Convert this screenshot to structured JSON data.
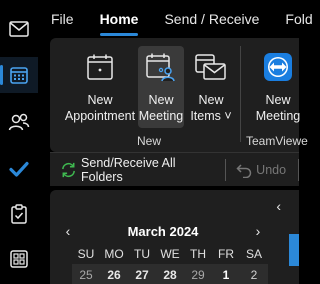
{
  "menu": {
    "tabs": [
      {
        "label": "File"
      },
      {
        "label": "Home"
      },
      {
        "label": "Send / Receive"
      },
      {
        "label": "Fold"
      }
    ],
    "active_tab": "Home"
  },
  "rail": {
    "items": [
      "mail-icon",
      "calendar-icon",
      "people-icon",
      "todo-check-icon",
      "clipboard-icon",
      "apps-icon"
    ],
    "active": "calendar-icon"
  },
  "ribbon": {
    "buttons": {
      "new_appointment": {
        "line1": "New",
        "line2": "Appointment"
      },
      "new_meeting": {
        "line1": "New",
        "line2": "Meeting"
      },
      "new_items": {
        "line1": "New",
        "line2": "Items ˅"
      },
      "teams_meeting": {
        "line1": "New",
        "line2": "Meeting"
      }
    },
    "groups": {
      "new": "New",
      "teamviewer": "TeamViewe"
    }
  },
  "quick_bar": {
    "send_receive_label": "Send/Receive All Folders",
    "undo_label": "Undo"
  },
  "calendar": {
    "title": "March 2024",
    "prev": "‹",
    "next": "›",
    "collapse": "‹",
    "days_of_week": [
      "SU",
      "MO",
      "TU",
      "WE",
      "TH",
      "FR",
      "SA"
    ],
    "first_row": [
      {
        "d": "25",
        "current_month": false
      },
      {
        "d": "26",
        "current_month": false,
        "bold": true
      },
      {
        "d": "27",
        "current_month": false,
        "bold": true
      },
      {
        "d": "28",
        "current_month": false,
        "bold": true
      },
      {
        "d": "29",
        "current_month": false
      },
      {
        "d": "1",
        "current_month": true,
        "bold": true
      },
      {
        "d": "2",
        "current_month": true
      }
    ]
  },
  "colors": {
    "accent": "#2b88d8",
    "ribbon_bg": "#1f1f1f",
    "app_bg": "#000000",
    "todo_check": "#2b88d8",
    "sync_green": "#3fb950"
  }
}
